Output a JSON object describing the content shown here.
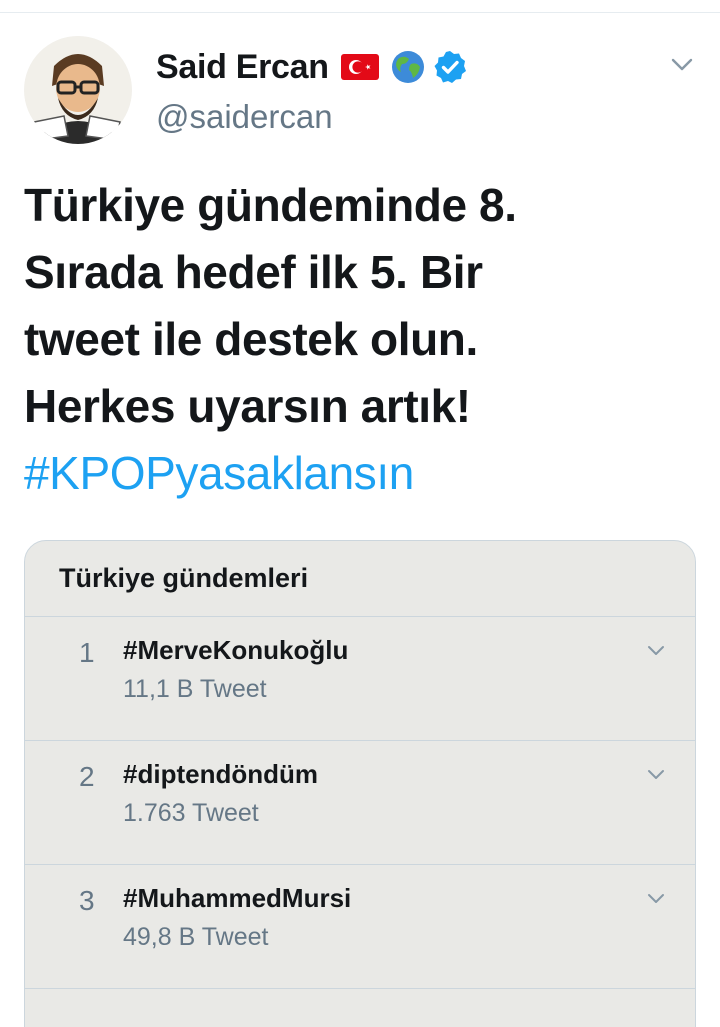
{
  "user": {
    "display_name": "Said Ercan",
    "handle": "@saidercan",
    "flag_icon": "turkey-flag-icon",
    "globe_icon": "globe-icon",
    "verified_icon": "verified-badge-icon"
  },
  "tweet": {
    "lines": [
      "Türkiye gündeminde 8.",
      "Sırada hedef ilk 5. Bir",
      "tweet ile destek olun.",
      "Herkes uyarsın artık!"
    ],
    "hashtag": "#KPOPyasaklansın"
  },
  "trends_card": {
    "title": "Türkiye gündemleri",
    "items": [
      {
        "rank": "1",
        "tag": "#MerveKonukoğlu",
        "count": "11,1 B Tweet"
      },
      {
        "rank": "2",
        "tag": "#diptendöndüm",
        "count": "1.763 Tweet"
      },
      {
        "rank": "3",
        "tag": "#MuhammedMursi",
        "count": "49,8 B Tweet"
      }
    ]
  },
  "colors": {
    "link_blue": "#1da1f2",
    "secondary_text": "#657786",
    "primary_text": "#14171a",
    "card_bg": "#e9e9e6"
  }
}
